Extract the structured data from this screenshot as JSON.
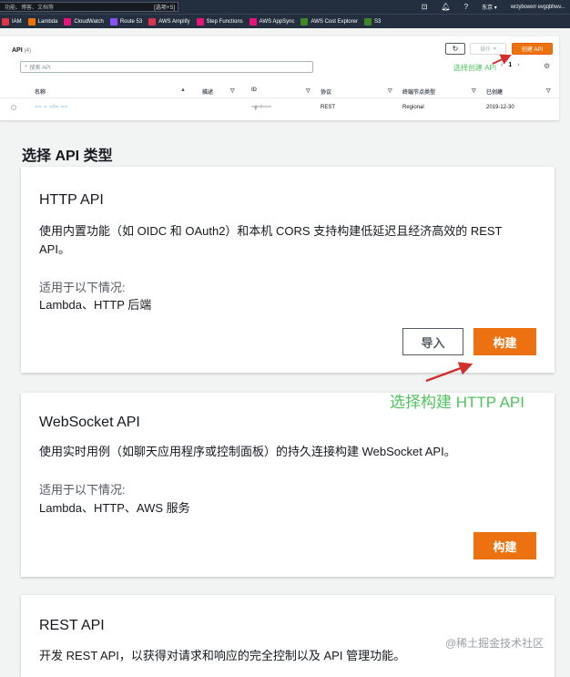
{
  "topnav": {
    "search_placeholder": "功能、博客、文档等",
    "search_hint": "[选项+S]",
    "account": "wrzybowxrr evgqbhwv...",
    "region": "东京 ▾"
  },
  "favorites": [
    {
      "label": "IAM",
      "color": "#dd344c"
    },
    {
      "label": "Lambda",
      "color": "#ed7100"
    },
    {
      "label": "CloudWatch",
      "color": "#e7157b"
    },
    {
      "label": "Route 53",
      "color": "#8c4fff"
    },
    {
      "label": "AWS Amplify",
      "color": "#dd344c"
    },
    {
      "label": "Step Functions",
      "color": "#e7157b"
    },
    {
      "label": "AWS AppSync",
      "color": "#e7157b"
    },
    {
      "label": "AWS Cost Explorer",
      "color": "#3f8624"
    },
    {
      "label": "S3",
      "color": "#3f8624"
    }
  ],
  "api_panel": {
    "title": "API",
    "count": "(4)",
    "search_placeholder": "搜索 API",
    "actions_label": "操作",
    "create_label": "创建 API",
    "annotation": "选择创建 API",
    "page": "1",
    "columns": [
      "名称",
      "描述",
      "ID",
      "协议",
      "终端节点类型",
      "已创建"
    ],
    "row": {
      "name": "~~ ~ ~!~ ~~",
      "id": "~y~!~~~",
      "protocol": "REST",
      "endpoint": "Regional",
      "created": "2019-12-30"
    }
  },
  "section_title": "选择 API 类型",
  "cards": [
    {
      "title": "HTTP API",
      "desc": "使用内置功能（如 OIDC 和 OAuth2）和本机 CORS 支持构建低延迟且经济高效的 REST API。",
      "use_label": "适用于以下情况:",
      "use_value": "Lambda、HTTP 后端",
      "import_label": "导入",
      "build_label": "构建"
    },
    {
      "title": "WebSocket API",
      "desc": "使用实时用例（如聊天应用程序或控制面板）的持久连接构建 WebSocket API。",
      "use_label": "适用于以下情况:",
      "use_value": "Lambda、HTTP、AWS 服务",
      "build_label": "构建"
    },
    {
      "title": "REST API",
      "desc": "开发 REST API，以获得对请求和响应的完全控制以及 API 管理功能。"
    }
  ],
  "annotation_big": "选择构建 HTTP API",
  "watermark": "@稀土掘金技术社区",
  "colors": {
    "accent": "#ec7211",
    "annotation": "#4fc45f",
    "arrow": "#d32f2f"
  }
}
